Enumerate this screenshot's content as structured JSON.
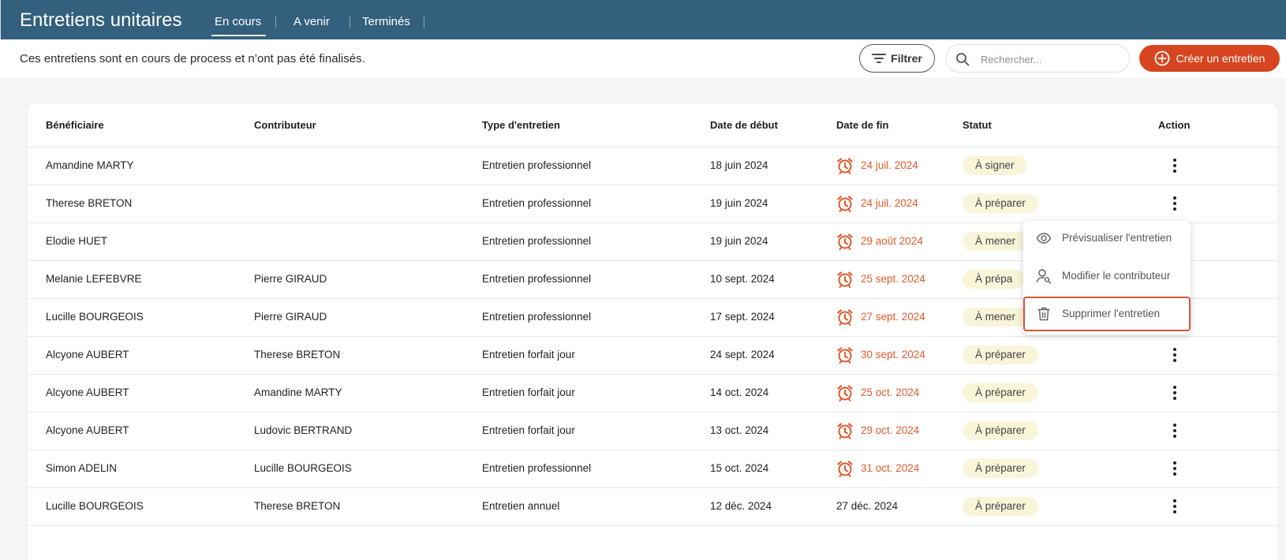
{
  "app": {
    "title": "Entretiens unitaires"
  },
  "tabs": [
    {
      "label": "En cours",
      "active": true
    },
    {
      "label": "A venir",
      "active": false
    },
    {
      "label": "Terminés",
      "active": false
    }
  ],
  "subheader": {
    "description": "Ces entretiens sont en cours de process et n’ont pas été finalisés."
  },
  "toolbar": {
    "filter_label": "Filtrer",
    "search_placeholder": "Rechercher...",
    "create_label": "Créer un entretien"
  },
  "table": {
    "headers": {
      "beneficiaire": "Bénéficiaire",
      "contributeur": "Contributeur",
      "type": "Type d'entretien",
      "debut": "Date de début",
      "fin": "Date de fin",
      "statut": "Statut",
      "action": "Action"
    },
    "rows": [
      {
        "beneficiaire": "Amandine MARTY",
        "contributeur": "",
        "type": "Entretien professionnel",
        "debut": "18 juin 2024",
        "fin": "24 juil. 2024",
        "late": true,
        "statut": "À signer"
      },
      {
        "beneficiaire": "Therese BRETON",
        "contributeur": "",
        "type": "Entretien professionnel",
        "debut": "19 juin 2024",
        "fin": "24 juil. 2024",
        "late": true,
        "statut": "À préparer"
      },
      {
        "beneficiaire": "Elodie HUET",
        "contributeur": "",
        "type": "Entretien professionnel",
        "debut": "19 juin 2024",
        "fin": "29 août 2024",
        "late": true,
        "statut": "À mener"
      },
      {
        "beneficiaire": "Melanie LEFEBVRE",
        "contributeur": "Pierre GIRAUD",
        "type": "Entretien professionnel",
        "debut": "10 sept. 2024",
        "fin": "25 sept. 2024",
        "late": true,
        "statut": "À prépa"
      },
      {
        "beneficiaire": "Lucille BOURGEOIS",
        "contributeur": "Pierre GIRAUD",
        "type": "Entretien professionnel",
        "debut": "17 sept. 2024",
        "fin": "27 sept. 2024",
        "late": true,
        "statut": "À mener"
      },
      {
        "beneficiaire": "Alcyone AUBERT",
        "contributeur": "Therese BRETON",
        "type": "Entretien forfait jour",
        "debut": "24 sept. 2024",
        "fin": "30 sept. 2024",
        "late": true,
        "statut": "À préparer"
      },
      {
        "beneficiaire": "Alcyone AUBERT",
        "contributeur": "Amandine MARTY",
        "type": "Entretien forfait jour",
        "debut": "14 oct. 2024",
        "fin": "25 oct. 2024",
        "late": true,
        "statut": "À préparer"
      },
      {
        "beneficiaire": "Alcyone AUBERT",
        "contributeur": "Ludovic BERTRAND",
        "type": "Entretien forfait jour",
        "debut": "13 oct. 2024",
        "fin": "29 oct. 2024",
        "late": true,
        "statut": "À préparer"
      },
      {
        "beneficiaire": "Simon ADELIN",
        "contributeur": "Lucille BOURGEOIS",
        "type": "Entretien professionnel",
        "debut": "15 oct. 2024",
        "fin": "31 oct. 2024",
        "late": true,
        "statut": "À préparer"
      },
      {
        "beneficiaire": "Lucille BOURGEOIS",
        "contributeur": "Therese BRETON",
        "type": "Entretien annuel",
        "debut": "12 déc. 2024",
        "fin": "27 déc. 2024",
        "late": false,
        "statut": "À préparer"
      }
    ]
  },
  "context_menu": {
    "items": [
      {
        "label": "Prévisualiser l'entretien",
        "icon": "eye-icon"
      },
      {
        "label": "Modifier le contributeur",
        "icon": "user-search-icon"
      },
      {
        "label": "Supprimer l'entretien",
        "icon": "trash-icon",
        "highlighted": true
      }
    ]
  },
  "colors": {
    "topbar": "#33607c",
    "accent": "#d64520",
    "late": "#e25a2c",
    "badge_bg": "#f8f5d9"
  }
}
